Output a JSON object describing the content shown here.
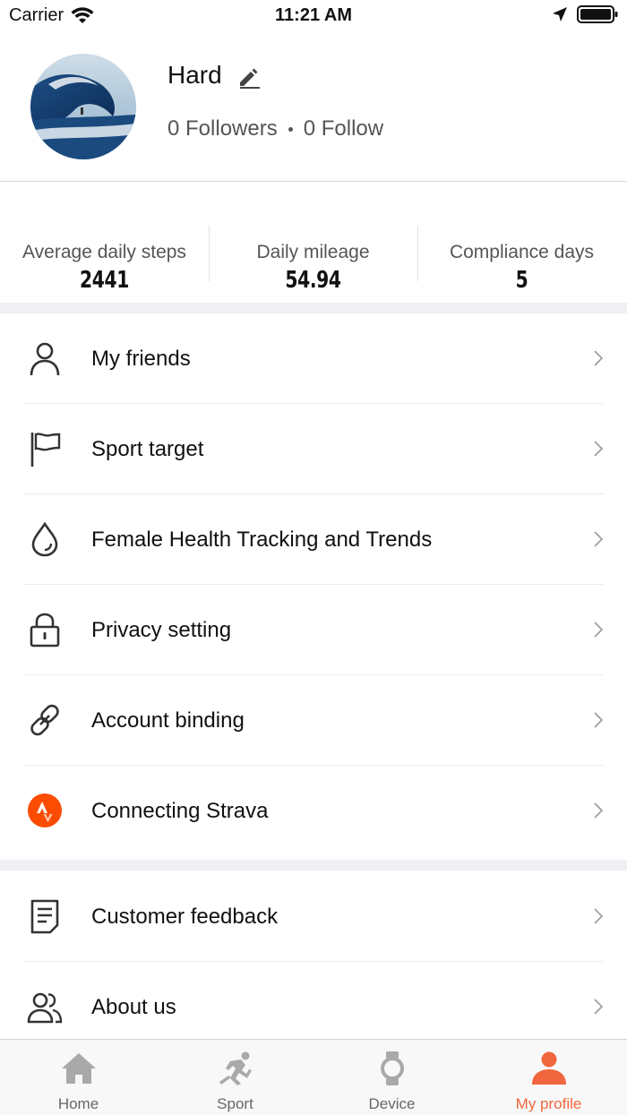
{
  "status_bar": {
    "carrier": "Carrier",
    "time": "11:21 AM"
  },
  "profile": {
    "name": "Hard",
    "followers": "0 Followers",
    "follow": "0 Follow"
  },
  "stats": [
    {
      "label": "Average daily steps",
      "value": "2441"
    },
    {
      "label": "Daily mileage",
      "value": "54.94"
    },
    {
      "label": "Compliance days",
      "value": "5"
    }
  ],
  "menu_group1": [
    {
      "label": "My friends",
      "icon": "person-icon"
    },
    {
      "label": "Sport target",
      "icon": "flag-icon"
    },
    {
      "label": "Female Health Tracking and Trends",
      "icon": "drop-icon"
    },
    {
      "label": "Privacy setting",
      "icon": "lock-icon"
    },
    {
      "label": "Account binding",
      "icon": "link-icon"
    },
    {
      "label": "Connecting Strava",
      "icon": "strava-icon"
    }
  ],
  "menu_group2": [
    {
      "label": "Customer feedback",
      "icon": "document-icon"
    },
    {
      "label": "About us",
      "icon": "people-icon"
    }
  ],
  "tabs": [
    {
      "label": "Home",
      "icon": "home-icon"
    },
    {
      "label": "Sport",
      "icon": "runner-icon"
    },
    {
      "label": "Device",
      "icon": "watch-icon"
    },
    {
      "label": "My profile",
      "icon": "profile-icon"
    }
  ],
  "colors": {
    "accent": "#f0663e",
    "strava": "#fc4c02",
    "section_gap": "#efeff4"
  }
}
